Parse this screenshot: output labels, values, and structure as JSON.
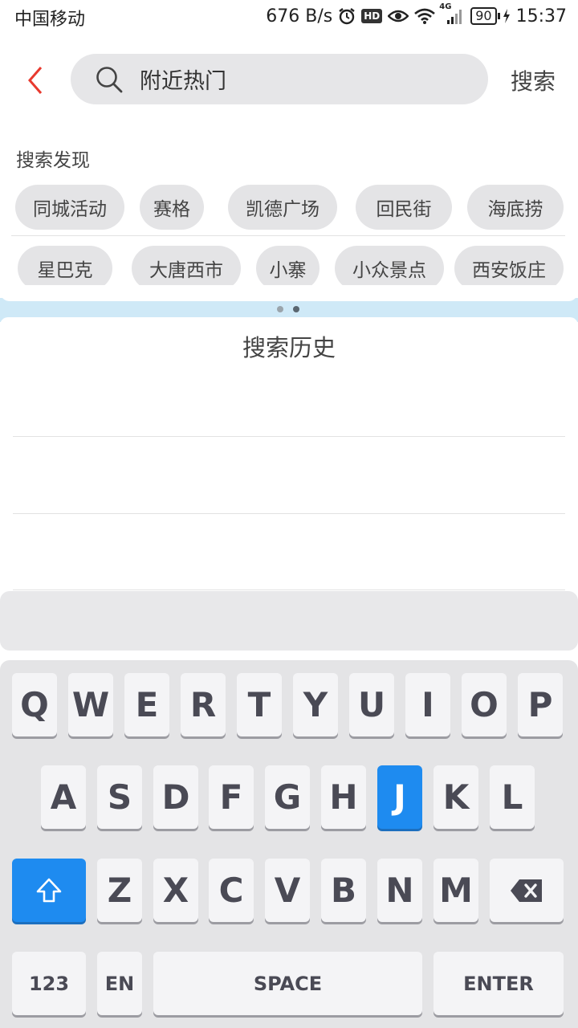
{
  "status_bar": {
    "carrier": "中国移动",
    "net_speed": "676 B/s",
    "hd_badge": "HD",
    "network_type": "4G",
    "battery": "90",
    "time": "15:37"
  },
  "search": {
    "query": "附近热门",
    "action_label": "搜索"
  },
  "discover": {
    "label": "搜索发现",
    "rows": [
      [
        "同城活动",
        "赛格",
        "凯德广场",
        "回民街",
        "海底捞"
      ],
      [
        "星巴克",
        "大唐西市",
        "小寨",
        "小众景点",
        "西安饭庄"
      ]
    ],
    "page_count": 2,
    "active_page": 1
  },
  "history": {
    "title": "搜索历史"
  },
  "keyboard": {
    "row1": [
      "Q",
      "W",
      "E",
      "R",
      "T",
      "Y",
      "U",
      "I",
      "O",
      "P"
    ],
    "row2": [
      "A",
      "S",
      "D",
      "F",
      "G",
      "H",
      "J",
      "K",
      "L"
    ],
    "row3": [
      "Z",
      "X",
      "C",
      "V",
      "B",
      "N",
      "M"
    ],
    "pressed_key": "J",
    "numbers_label": "123",
    "language_label": "EN",
    "space_label": "SPACE",
    "enter_label": "ENTER"
  },
  "colors": {
    "accent": "#1e8bf0",
    "back_arrow": "#e8392e",
    "panel_strip": "#cfe9f7"
  }
}
